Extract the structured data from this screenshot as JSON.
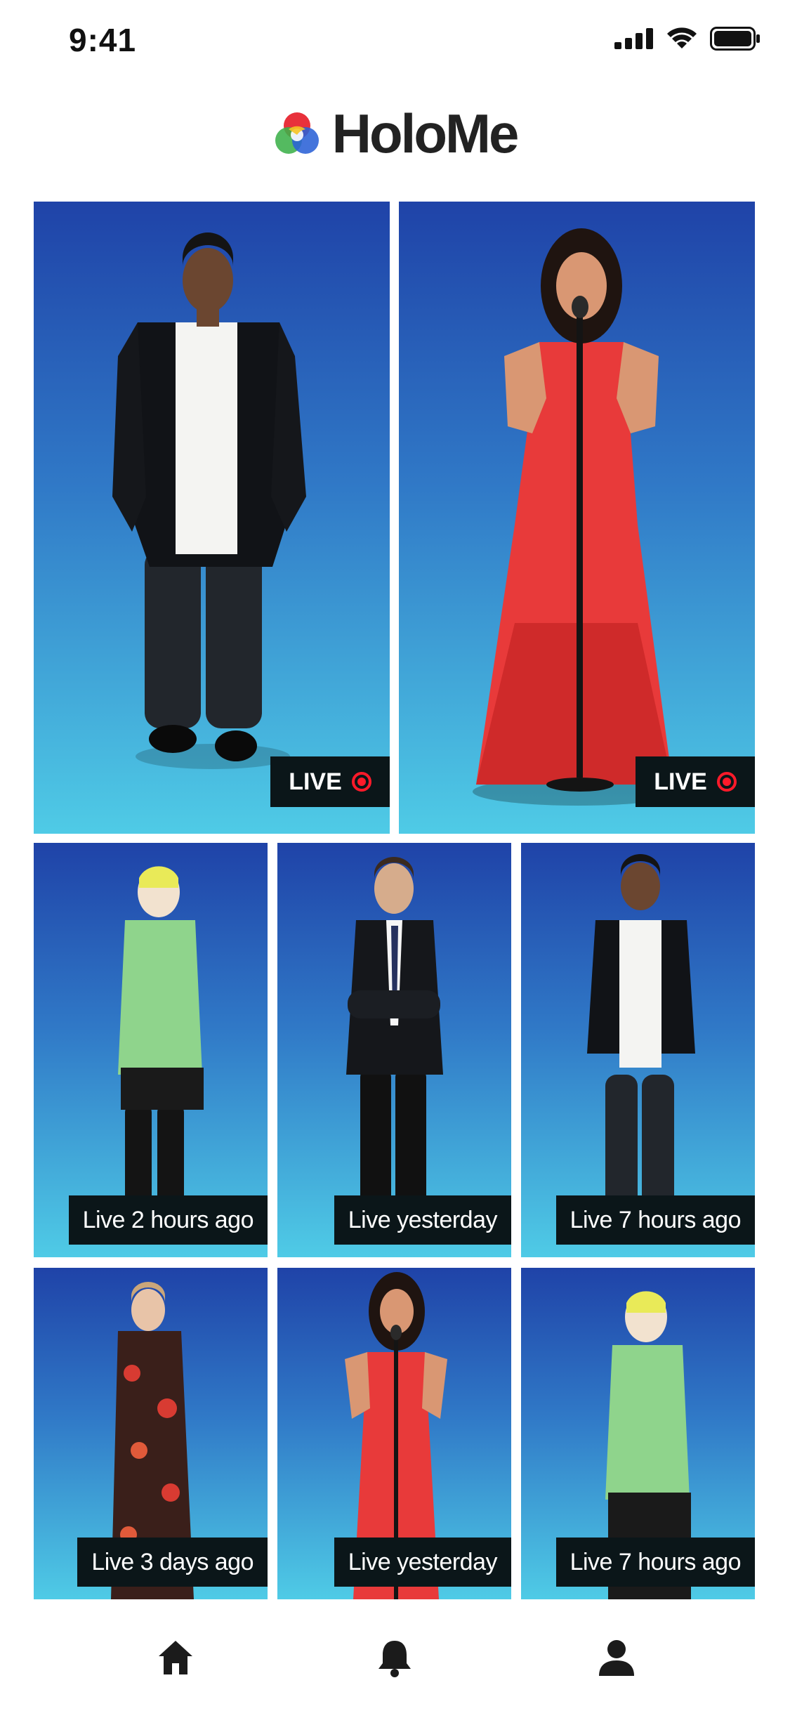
{
  "status_bar": {
    "time": "9:41"
  },
  "header": {
    "app_name": "HoloMe",
    "logo_colors": [
      "#e6202a",
      "#f6c324",
      "#3cb14a",
      "#2a61d6"
    ]
  },
  "feed": {
    "featured": [
      {
        "person": "man in black blazer and white t-shirt",
        "badge": "LIVE"
      },
      {
        "person": "woman in red gown singing at microphone",
        "badge": "LIVE"
      }
    ],
    "grid": [
      {
        "person": "young man in green denim jacket and yellow beanie",
        "caption": "Live 2 hours ago"
      },
      {
        "person": "man in black suit with arms crossed",
        "caption": "Live yesterday"
      },
      {
        "person": "man in black blazer and white t-shirt",
        "caption": "Live 7 hours ago"
      },
      {
        "person": "woman in floral dress",
        "caption": "Live 3 days ago"
      },
      {
        "person": "woman in red gown singing at microphone",
        "caption": "Live yesterday"
      },
      {
        "person": "young man in green denim jacket and yellow beanie",
        "caption": "Live 7 hours ago"
      }
    ]
  },
  "tab_bar": {
    "items": [
      "home-icon",
      "bell-icon",
      "profile-icon"
    ]
  }
}
